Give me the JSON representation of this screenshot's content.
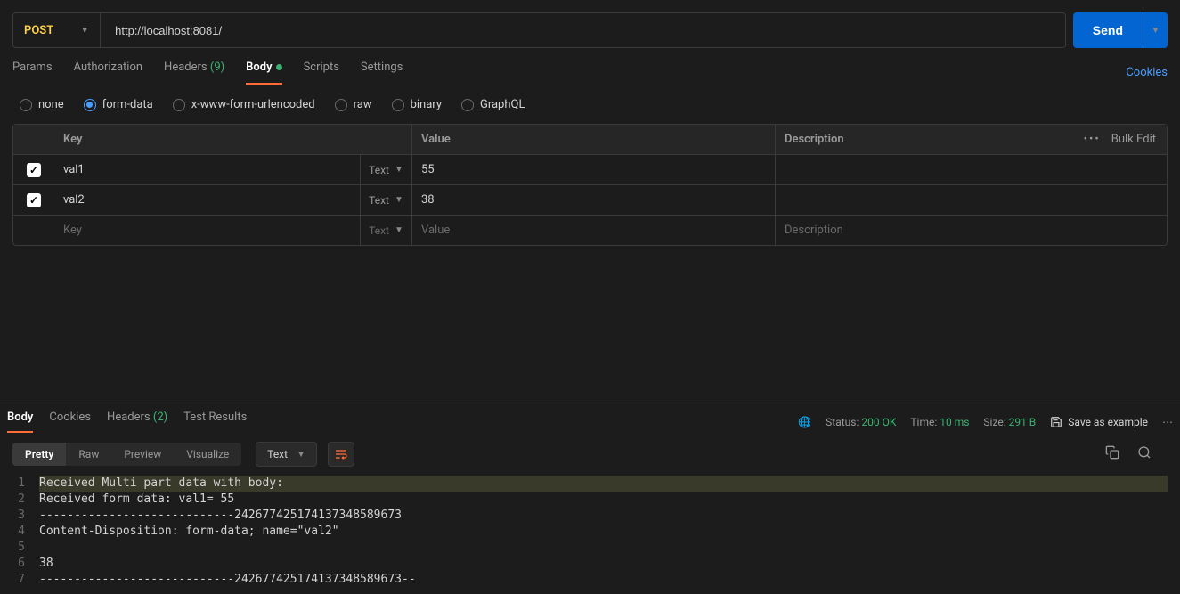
{
  "request": {
    "method": "POST",
    "url": "http://localhost:8081/",
    "send_label": "Send"
  },
  "req_tabs": {
    "params": "Params",
    "authorization": "Authorization",
    "headers": "Headers",
    "headers_count": "(9)",
    "body": "Body",
    "scripts": "Scripts",
    "settings": "Settings",
    "cookies": "Cookies"
  },
  "body_types": {
    "none": "none",
    "form_data": "form-data",
    "urlencoded": "x-www-form-urlencoded",
    "raw": "raw",
    "binary": "binary",
    "graphql": "GraphQL"
  },
  "form_table": {
    "headers": {
      "key": "Key",
      "value": "Value",
      "description": "Description"
    },
    "bulk_edit": "Bulk Edit",
    "type_label": "Text",
    "rows": [
      {
        "key": "val1",
        "value": "55",
        "desc": ""
      },
      {
        "key": "val2",
        "value": "38",
        "desc": ""
      }
    ],
    "placeholders": {
      "key": "Key",
      "value": "Value",
      "desc": "Description",
      "type": "Text"
    }
  },
  "response": {
    "tabs": {
      "body": "Body",
      "cookies": "Cookies",
      "headers": "Headers",
      "headers_count": "(2)",
      "tests": "Test Results"
    },
    "status": {
      "label": "Status:",
      "value": "200 OK",
      "time_label": "Time:",
      "time_value": "10 ms",
      "size_label": "Size:",
      "size_value": "291 B",
      "save": "Save as example"
    },
    "views": {
      "pretty": "Pretty",
      "raw": "Raw",
      "preview": "Preview",
      "visualize": "Visualize"
    },
    "format": "Text",
    "lines": [
      "Received Multi part data with body:",
      "Received form data: val1= 55",
      "----------------------------242677425174137348589673",
      "Content-Disposition: form-data; name=\"val2\"",
      "",
      "38",
      "----------------------------242677425174137348589673--"
    ]
  }
}
